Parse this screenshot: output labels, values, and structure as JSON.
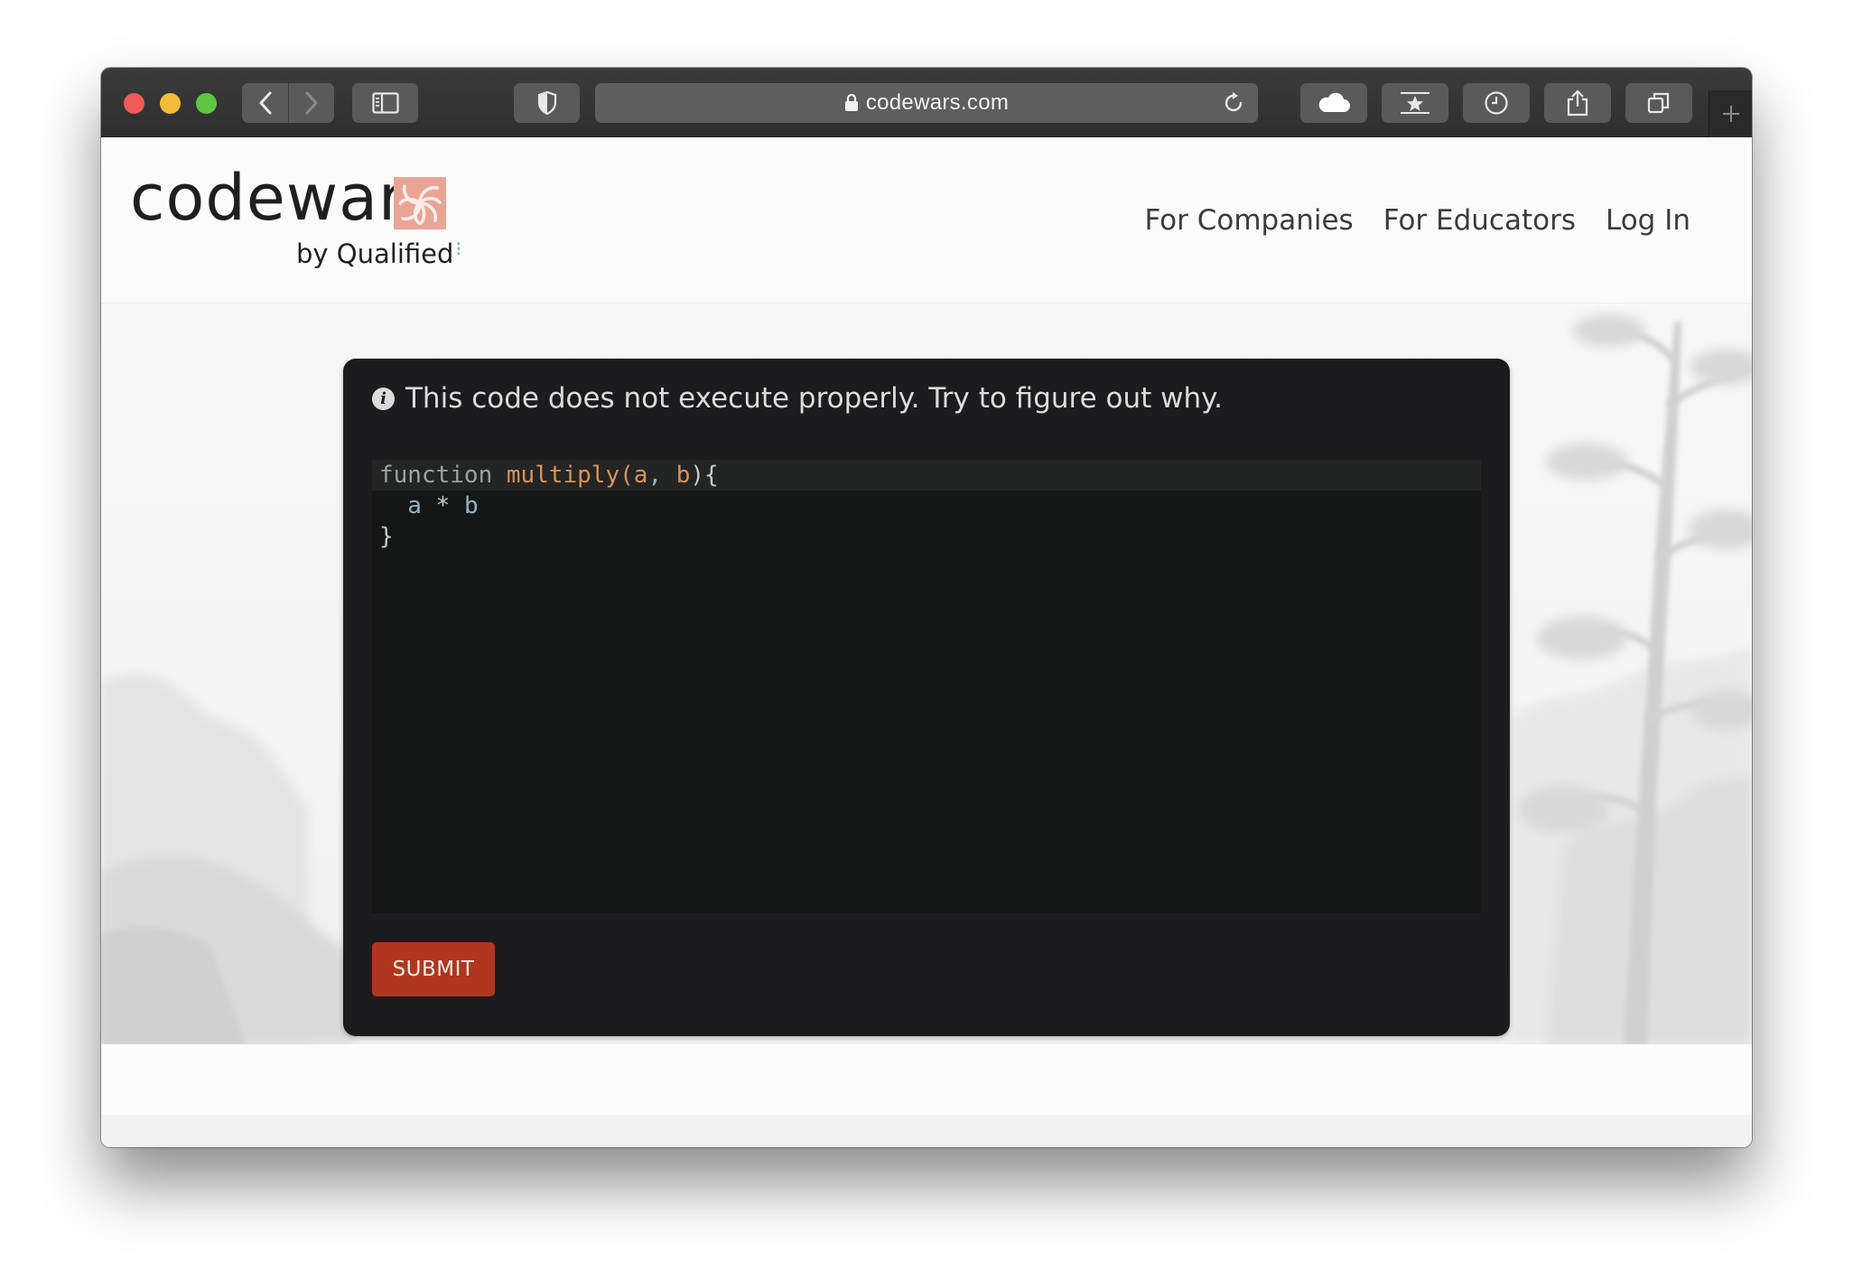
{
  "browser": {
    "url": "codewars.com",
    "icons": [
      "back-icon",
      "forward-icon",
      "sidebar-icon",
      "shield-icon",
      "lock-icon",
      "reload-icon",
      "cloud-icon",
      "star-icon",
      "history-icon",
      "share-icon",
      "tabs-icon",
      "plus-icon"
    ],
    "new_tab_label": "+"
  },
  "site": {
    "logo_text": "codewars",
    "byline": "by Qualified",
    "nav": [
      "For Companies",
      "For Educators",
      "Log In"
    ],
    "brand_color": "#b1361e"
  },
  "card": {
    "message": "This code does not execute properly. Try to figure out why.",
    "info_icon_glyph": "i",
    "code_lines": [
      {
        "tokens": [
          {
            "t": "function",
            "c": "kw"
          },
          {
            "t": " ",
            "c": "punct"
          },
          {
            "t": "multiply",
            "c": "fn"
          },
          {
            "t": "(",
            "c": "fn"
          },
          {
            "t": "a",
            "c": "fn"
          },
          {
            "t": ", ",
            "c": "param"
          },
          {
            "t": "b",
            "c": "fn"
          },
          {
            "t": "){",
            "c": "punct"
          }
        ]
      },
      {
        "tokens": [
          {
            "t": "  a",
            "c": "param"
          },
          {
            "t": " * ",
            "c": "punct"
          },
          {
            "t": "b",
            "c": "param"
          }
        ]
      },
      {
        "tokens": [
          {
            "t": "}",
            "c": "punct"
          }
        ]
      }
    ],
    "submit_label": "SUBMIT"
  }
}
